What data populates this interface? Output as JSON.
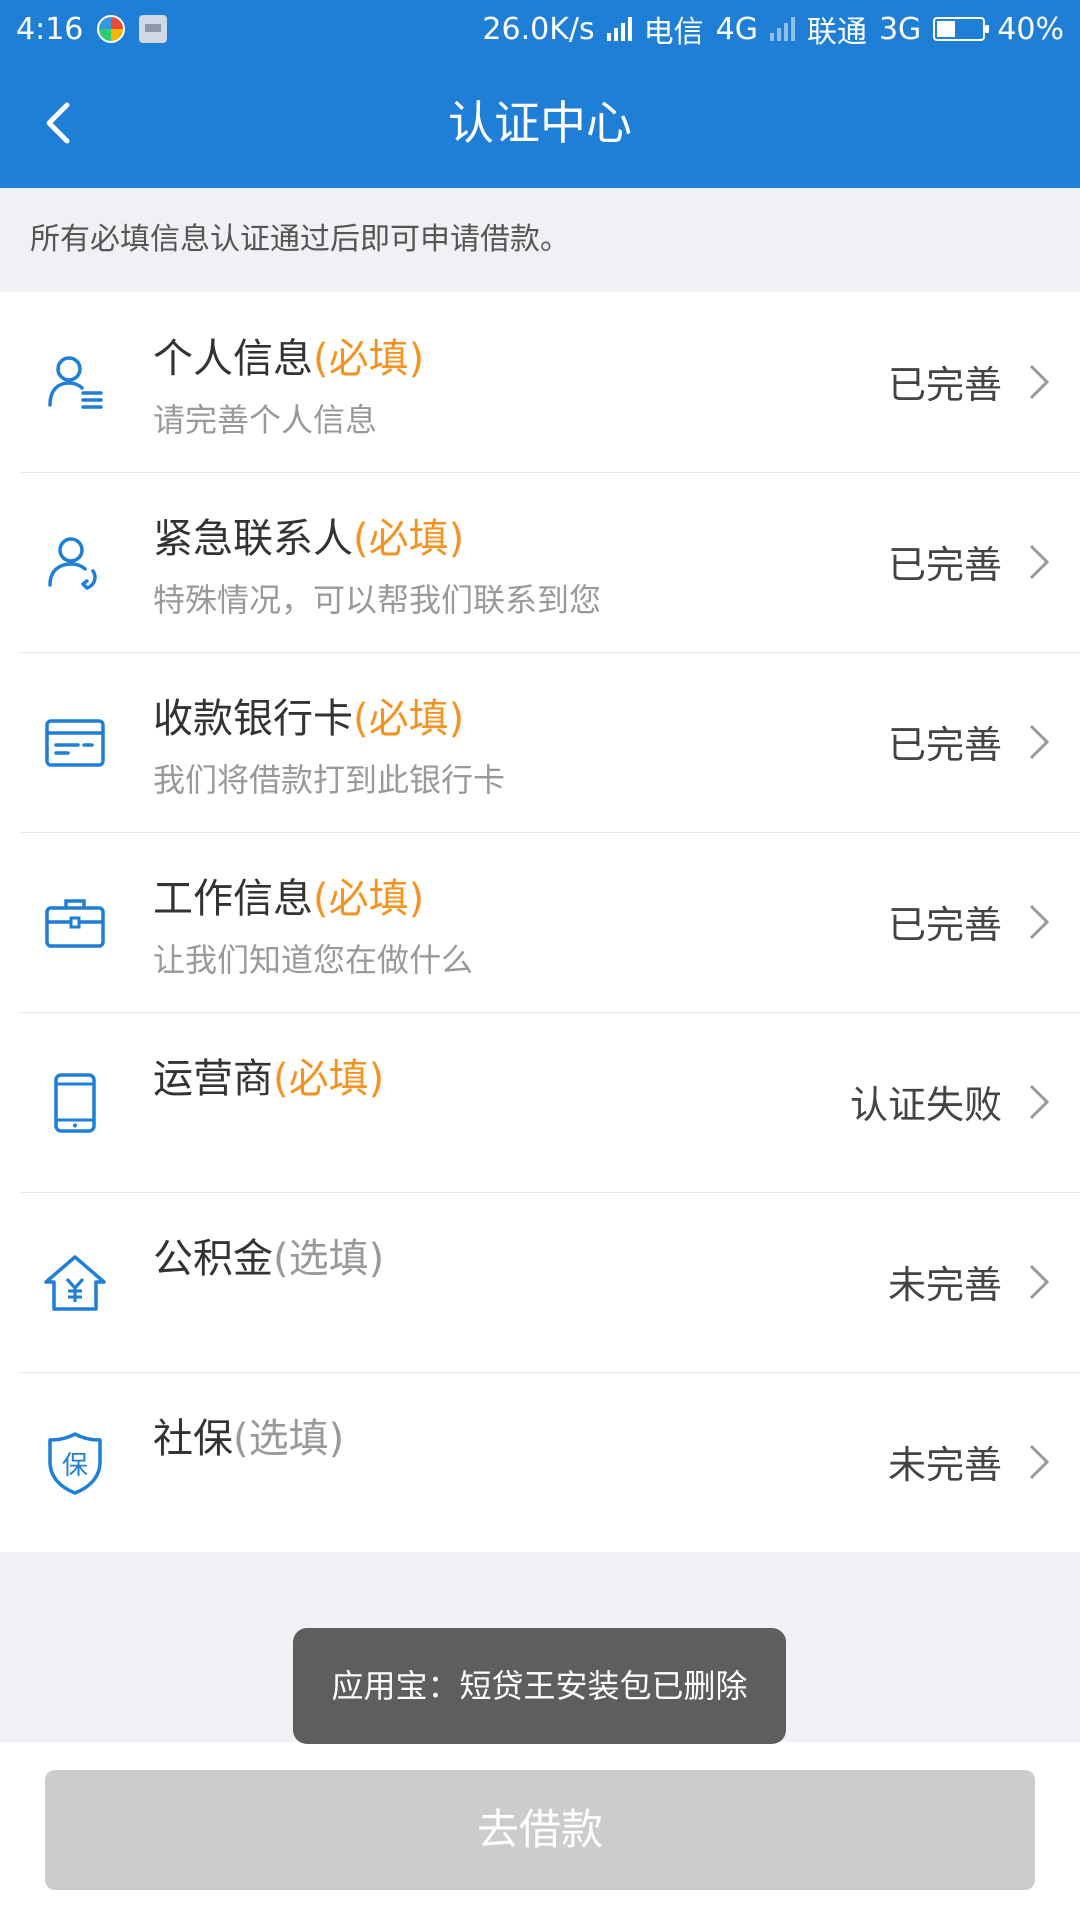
{
  "status_bar": {
    "time": "4:16",
    "net_speed": "26.0K/s",
    "carrier1": "电信",
    "net1": "4G",
    "carrier2": "联通",
    "net2": "3G",
    "battery": "40%",
    "battery_level": 0.4
  },
  "header": {
    "title": "认证中心",
    "accent_color": "#1f7ed6"
  },
  "notice": "所有必填信息认证通过后即可申请借款。",
  "items": [
    {
      "icon": "person-icon",
      "title": "个人信息",
      "tag": "(必填)",
      "subtitle": "请完善个人信息",
      "status": "已完善"
    },
    {
      "icon": "contact-phone-icon",
      "title": "紧急联系人",
      "tag": "(必填)",
      "subtitle": "特殊情况，可以帮我们联系到您",
      "status": "已完善"
    },
    {
      "icon": "bank-card-icon",
      "title": "收款银行卡",
      "tag": "(必填)",
      "subtitle": "我们将借款打到此银行卡",
      "status": "已完善"
    },
    {
      "icon": "briefcase-icon",
      "title": "工作信息",
      "tag": "(必填)",
      "subtitle": "让我们知道您在做什么",
      "status": "已完善"
    },
    {
      "icon": "mobile-phone-icon",
      "title": "运营商",
      "tag": "(必填)",
      "subtitle": "",
      "status": "认证失败"
    },
    {
      "icon": "housing-fund-icon",
      "title": "公积金",
      "tag": "(选填)",
      "subtitle": "",
      "status": "未完善"
    },
    {
      "icon": "social-security-shield-icon",
      "title": "社保",
      "tag": "(选填)",
      "subtitle": "",
      "status": "未完善"
    }
  ],
  "toast": "应用宝：短贷王安装包已删除",
  "borrow_button": "去借款",
  "colors": {
    "required_tag": "#f39321",
    "optional_tag": "#999999",
    "disabled_button": "#cccccc"
  }
}
